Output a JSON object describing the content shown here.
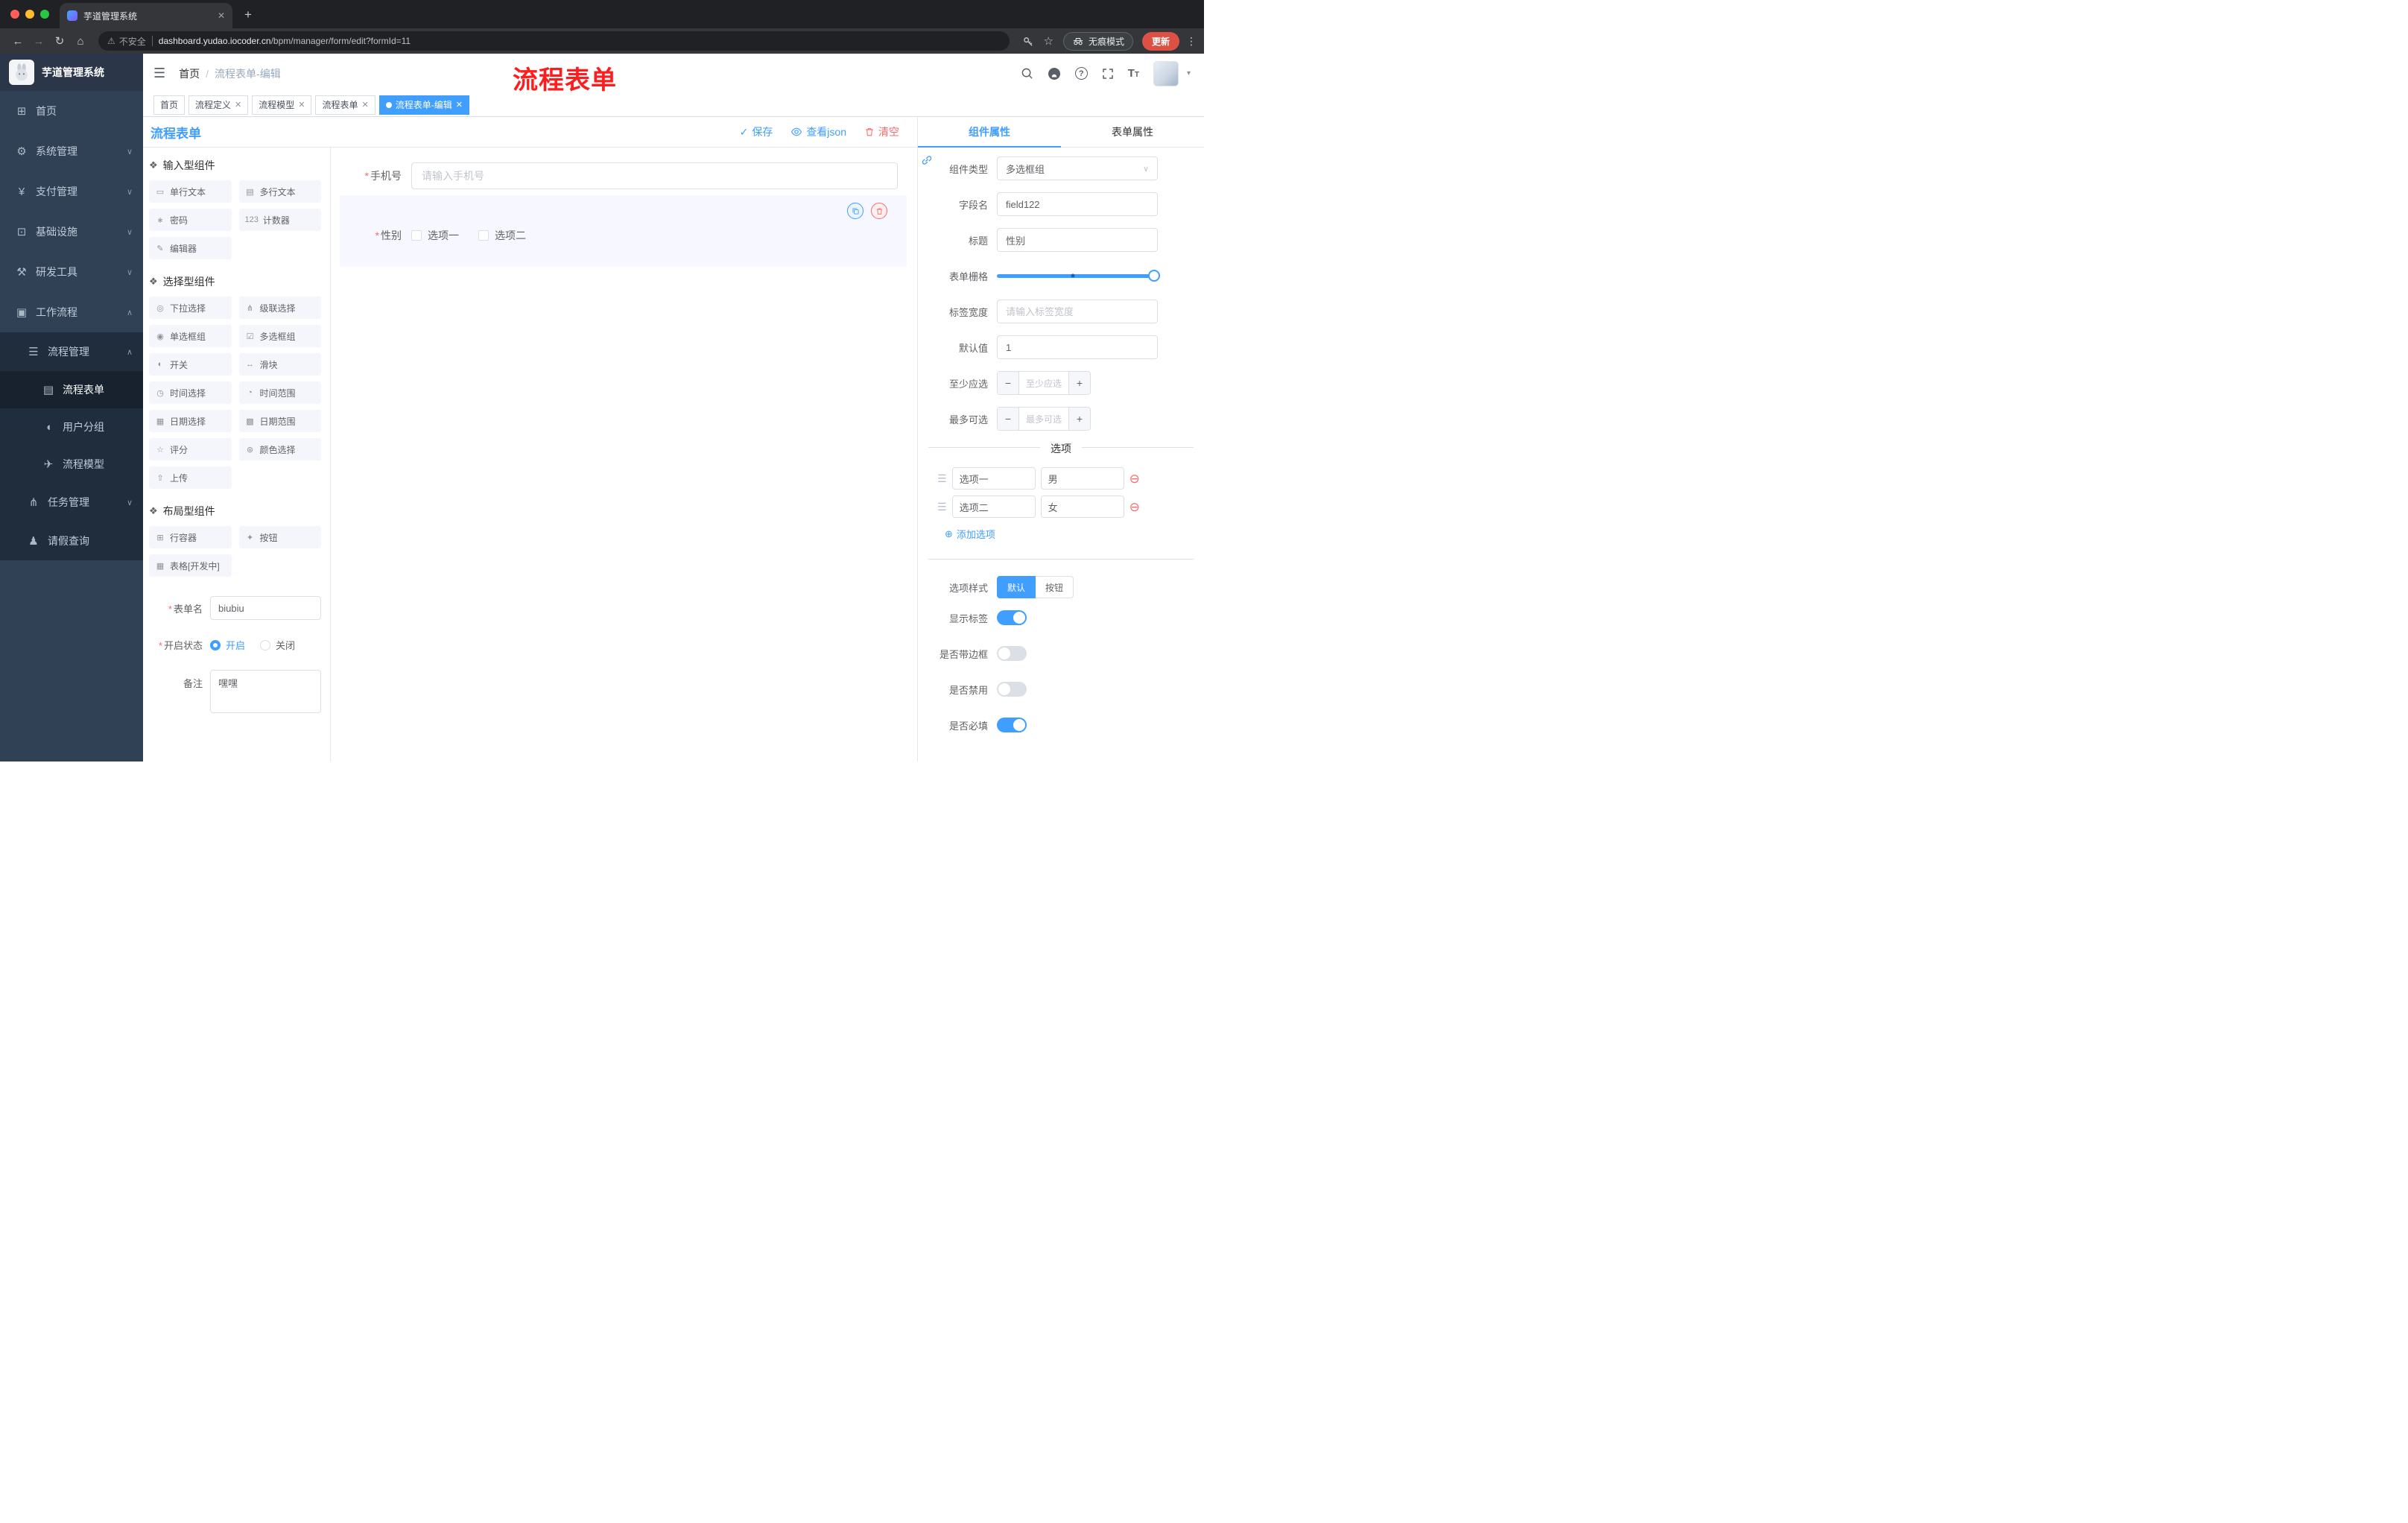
{
  "colors": {
    "accent": "#409eff",
    "danger": "#f56c6c",
    "update_button": "#dd5144",
    "sidebar": "#304156",
    "selected_block": "#f6f7ff"
  },
  "browser": {
    "tab_title": "芋道管理系统",
    "security_label": "不安全",
    "url_host": "dashboard.yudao.iocoder.cn",
    "url_path": "/bpm/manager/form/edit?formId=11",
    "incognito_label": "无痕模式",
    "update_label": "更新"
  },
  "sidebar": {
    "logo_title": "芋道管理系统",
    "items": [
      {
        "icon": "⊞",
        "label": "首页"
      },
      {
        "icon": "⚙",
        "label": "系统管理",
        "arrow": "∨"
      },
      {
        "icon": "¥",
        "label": "支付管理",
        "arrow": "∨"
      },
      {
        "icon": "⊡",
        "label": "基础设施",
        "arrow": "∨"
      },
      {
        "icon": "⚒",
        "label": "研发工具",
        "arrow": "∨"
      },
      {
        "icon": "▣",
        "label": "工作流程",
        "arrow": "∧"
      },
      {
        "icon": "☰",
        "label": "流程管理",
        "arrow": "∧"
      },
      {
        "icon": "▤",
        "label": "流程表单"
      },
      {
        "icon": "◖",
        "label": "用户分组"
      },
      {
        "icon": "✈",
        "label": "流程模型"
      },
      {
        "icon": "⋔",
        "label": "任务管理",
        "arrow": "∨"
      },
      {
        "icon": "♟",
        "label": "请假查询"
      }
    ]
  },
  "header": {
    "breadcrumb_home": "首页",
    "breadcrumb_sep": "/",
    "breadcrumb_current": "流程表单-编辑",
    "overlay_title": "流程表单"
  },
  "tags": [
    {
      "label": "首页"
    },
    {
      "label": "流程定义"
    },
    {
      "label": "流程模型"
    },
    {
      "label": "流程表单"
    },
    {
      "label": "流程表单-编辑"
    }
  ],
  "editor": {
    "title": "流程表单",
    "save": "保存",
    "view_json": "查看json",
    "clear": "清空",
    "required_mark": "*"
  },
  "palette": {
    "sections": [
      {
        "icon": "❖",
        "title": "输入型组件",
        "items": [
          {
            "icon": "▭",
            "label": "单行文本"
          },
          {
            "icon": "▤",
            "label": "多行文本"
          },
          {
            "icon": "∗",
            "label": "密码"
          },
          {
            "icon": "123",
            "label": "计数器"
          },
          {
            "icon": "✎",
            "label": "编辑器"
          }
        ]
      },
      {
        "icon": "❖",
        "title": "选择型组件",
        "items": [
          {
            "icon": "◎",
            "label": "下拉选择"
          },
          {
            "icon": "⋔",
            "label": "级联选择"
          },
          {
            "icon": "◉",
            "label": "单选框组"
          },
          {
            "icon": "☑",
            "label": "多选框组"
          },
          {
            "icon": "◐",
            "label": "开关"
          },
          {
            "icon": "↔",
            "label": "滑块"
          },
          {
            "icon": "◷",
            "label": "时间选择"
          },
          {
            "icon": "◔",
            "label": "时间范围"
          },
          {
            "icon": "▦",
            "label": "日期选择"
          },
          {
            "icon": "▩",
            "label": "日期范围"
          },
          {
            "icon": "☆",
            "label": "评分"
          },
          {
            "icon": "⊛",
            "label": "颜色选择"
          },
          {
            "icon": "⇧",
            "label": "上传"
          }
        ]
      },
      {
        "icon": "❖",
        "title": "布局型组件",
        "items": [
          {
            "icon": "⊞",
            "label": "行容器"
          },
          {
            "icon": "✦",
            "label": "按钮"
          },
          {
            "icon": "▦",
            "label": "表格[开发中]"
          }
        ]
      }
    ],
    "form": {
      "name_label": "表单名",
      "name_value": "biubiu",
      "status_label": "开启状态",
      "status_on": "开启",
      "status_off": "关闭",
      "remark_label": "备注",
      "remark_value": "嘿嘿"
    }
  },
  "canvas": {
    "phone_label": "手机号",
    "phone_placeholder": "请输入手机号",
    "gender_label": "性别",
    "option1": "选项一",
    "option2": "选项二"
  },
  "props": {
    "tab_component": "组件属性",
    "tab_form": "表单属性",
    "type_label": "组件类型",
    "type_value": "多选框组",
    "field_label": "字段名",
    "field_value": "field122",
    "title_label": "标题",
    "title_value": "性别",
    "grid_label": "表单栅格",
    "width_label": "标签宽度",
    "width_placeholder": "请输入标签宽度",
    "default_label": "默认值",
    "default_value": "1",
    "min_label": "至少应选",
    "min_placeholder": "至少应选",
    "max_label": "最多可选",
    "max_placeholder": "最多可选",
    "options_title": "选项",
    "options": [
      {
        "label": "选项一",
        "value": "男"
      },
      {
        "label": "选项二",
        "value": "女"
      }
    ],
    "add_option": "添加选项",
    "style_label": "选项样式",
    "style_default": "默认",
    "style_button": "按钮",
    "toggle_show_label": "显示标签",
    "toggle_border_label": "是否带边框",
    "toggle_disabled_label": "是否禁用",
    "toggle_required_label": "是否必填"
  }
}
